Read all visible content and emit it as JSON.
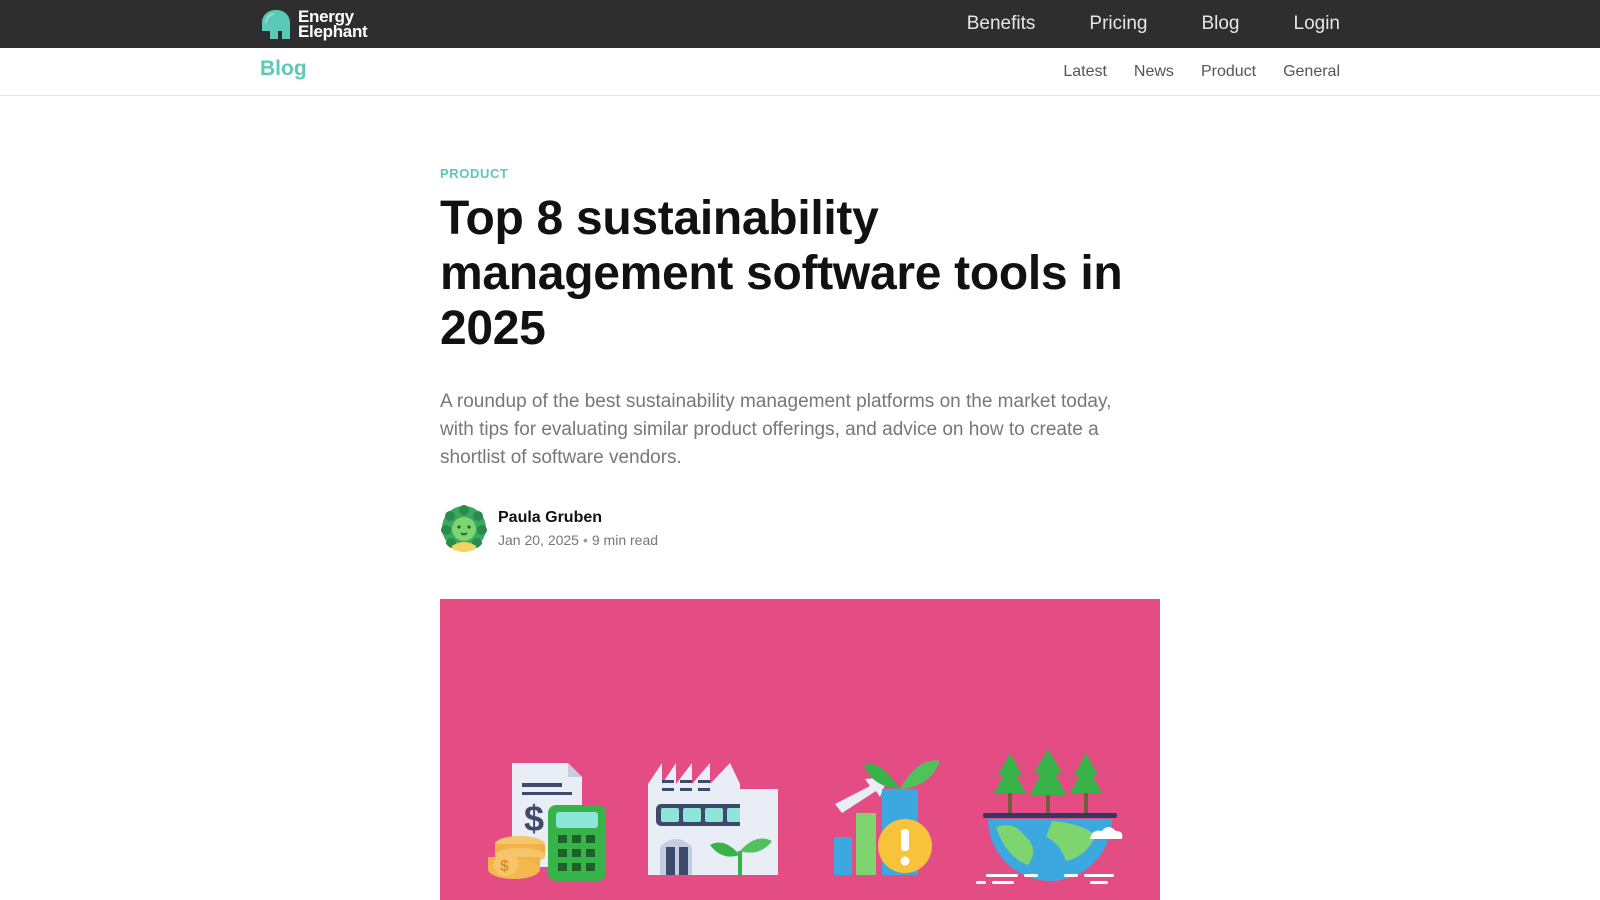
{
  "header": {
    "logo_line1": "Energy",
    "logo_line2": "Elephant",
    "nav": [
      "Benefits",
      "Pricing",
      "Blog",
      "Login"
    ]
  },
  "subheader": {
    "section": "Blog",
    "nav": [
      "Latest",
      "News",
      "Product",
      "General"
    ]
  },
  "article": {
    "category": "PRODUCT",
    "title": "Top 8 sustainability management software tools in 2025",
    "excerpt": "A roundup of the best sustainability management platforms on the market today, with tips for evaluating similar product offerings, and advice on how to create a shortlist of software vendors.",
    "author": "Paula Gruben",
    "date": "Jan 20, 2025",
    "read_time": "9 min read"
  },
  "colors": {
    "accent": "#5bc8b8",
    "topbar": "#2e2e2e",
    "hero_bg": "#e34d84"
  }
}
